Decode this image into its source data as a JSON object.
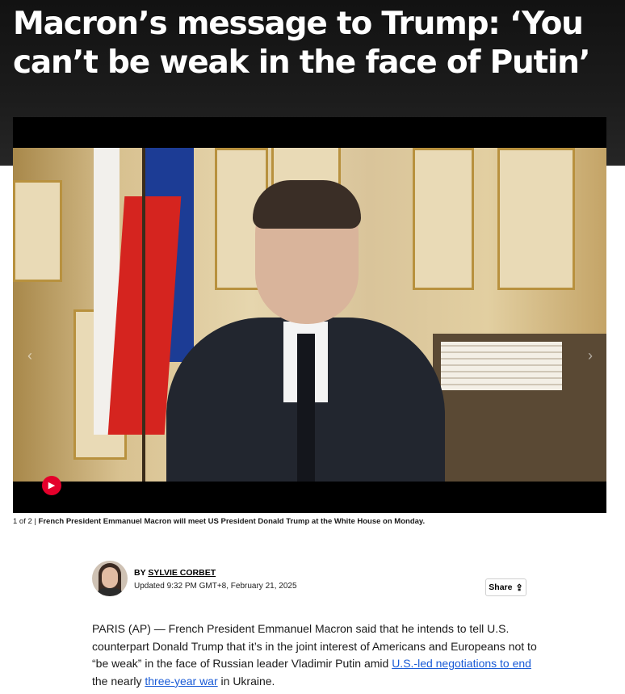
{
  "article": {
    "headline": "Macron’s message to Trump: ‘You can’t be weak in the face of Putin’",
    "caption_counter": "1 of 2 |",
    "caption_text": "French President Emmanuel Macron will meet US President Donald Trump at the White House on Monday.",
    "byline_prefix": "BY",
    "author": "SYLVIE CORBET",
    "updated": "Updated 9:32 PM GMT+8, February 21, 2025",
    "share_label": "Share",
    "body": {
      "part1": "PARIS (AP) — French President Emmanuel Macron said that he intends to tell U.S. counterpart Donald Trump that it’s in the joint interest of Americans and Europeans not to “be weak” in the face of Russian leader Vladimir Putin amid ",
      "link1": "U.S.-led negotiations to end",
      "part2": " the nearly ",
      "link2": "three-year war",
      "part3": " in Ukraine."
    }
  },
  "icons": {
    "play": "play-icon",
    "share": "share-icon",
    "prev": "chevron-left-icon",
    "next": "chevron-right-icon"
  },
  "colors": {
    "play_button": "#e4002b",
    "link": "#1a5bd6",
    "hero_background": "#1a1a1a"
  }
}
